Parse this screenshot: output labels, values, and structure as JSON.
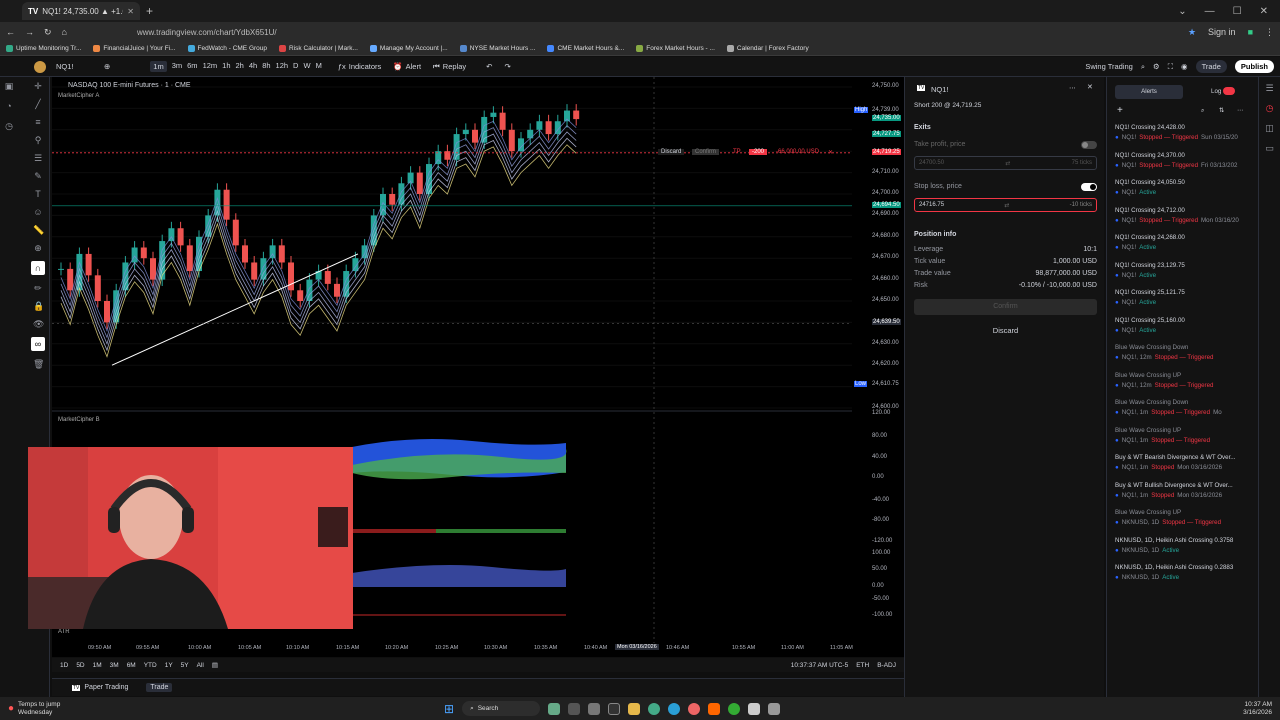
{
  "browser": {
    "tab_title": "NQ1! 24,735.00 ▲ +1.64% Swi",
    "url": "www.tradingview.com/chart/YdbX651U/",
    "sign_in": "Sign in",
    "bookmarks": [
      "Uptime Monitoring Tr...",
      "FinancialJuice | Your Fi...",
      "FedWatch - CME Group",
      "Risk Calculator | Mark...",
      "Manage My Account |...",
      "NYSE Market Hours ...",
      "CME Market Hours &...",
      "Forex Market Hours - ...",
      "Calendar | Forex Factory"
    ]
  },
  "toolbar": {
    "symbol": "NQ1!",
    "timeframes": [
      "1m",
      "3m",
      "6m",
      "12m",
      "1h",
      "2h",
      "4h",
      "8h",
      "12h",
      "D",
      "W",
      "M"
    ],
    "selected_tf": "1m",
    "indicators": "Indicators",
    "alert": "Alert",
    "replay": "Replay",
    "layout_name": "Swing Trading",
    "trade": "Trade",
    "publish": "Publish"
  },
  "chart": {
    "title": "NASDAQ 100 E-mini Futures · 1 · CME",
    "indicator_a": "MarketCipher A",
    "indicator_b": "MarketCipher B",
    "atr": "ATR",
    "high_label": "High",
    "low_label": "Low",
    "order_discard": "Discard",
    "order_confirm": "Confirm",
    "order_tp": "TP",
    "order_qty": "-200",
    "order_pnl": "-66,000.00 USD",
    "price_labels": [
      {
        "v": "24,750.00"
      },
      {
        "v": "24,739.00",
        "hl": "High"
      },
      {
        "v": "24,727.75"
      },
      {
        "v": "24,735.00"
      },
      {
        "v": "24,719.25"
      },
      {
        "v": "24,710.00"
      },
      {
        "v": "24,700.00"
      },
      {
        "v": "24,694.50"
      },
      {
        "v": "24,690.00"
      },
      {
        "v": "24,680.00"
      },
      {
        "v": "24,670.00"
      },
      {
        "v": "24,660.00"
      },
      {
        "v": "24,650.00"
      },
      {
        "v": "24,639.50"
      },
      {
        "v": "24,630.00"
      },
      {
        "v": "24,620.00"
      },
      {
        "v": "24,610.75"
      },
      {
        "v": "24,600.00"
      }
    ],
    "osc_labels": [
      "120.00",
      "80.00",
      "40.00",
      "0.00",
      "-40.00",
      "-80.00",
      "-120.00",
      "100.00",
      "50.00",
      "0.00",
      "-50.00",
      "-100.00"
    ],
    "time_labels": [
      "09:50 AM",
      "09:55 AM",
      "10:00 AM",
      "10:05 AM",
      "10:10 AM",
      "10:15 AM",
      "10:20 AM",
      "10:25 AM",
      "10:30 AM",
      "10:35 AM",
      "10:40 AM",
      "10:46 AM",
      "10:55 AM",
      "11:00 AM",
      "11:05 AM"
    ],
    "cursor_date": "Mon 03/16/2026",
    "ranges": [
      "1D",
      "5D",
      "1M",
      "3M",
      "6M",
      "YTD",
      "1Y",
      "5Y",
      "All"
    ],
    "clock": "10:37:37 AM UTC-5",
    "session": "ETH",
    "adj": "B-ADJ"
  },
  "order_panel": {
    "symbol": "NQ1!",
    "subtitle": "Short 200 @ 24,719.25",
    "exits": "Exits",
    "take_profit": "Take profit, price",
    "tp_value": "24700.50",
    "tp_ticks": "75 ticks",
    "stop_loss": "Stop loss, price",
    "sl_value": "24716.75",
    "sl_ticks": "-10 ticks",
    "position_info": "Position info",
    "rows": [
      {
        "k": "Leverage",
        "v": "10:1"
      },
      {
        "k": "Tick value",
        "v": "1,000.00 USD"
      },
      {
        "k": "Trade value",
        "v": "98,877,000.00 USD"
      },
      {
        "k": "Risk",
        "v": "-0.10% / -10,000.00 USD"
      }
    ],
    "confirm": "Confirm",
    "discard": "Discard"
  },
  "alerts": {
    "tab_alerts": "Alerts",
    "tab_log": "Log",
    "items": [
      {
        "t": "NQ1! Crossing 24,428.00",
        "s": "NQ1!",
        "st": "Stopped — Triggered",
        "d": "Sun 03/15/20"
      },
      {
        "t": "NQ1! Crossing 24,370.00",
        "s": "NQ1!",
        "st": "Stopped — Triggered",
        "d": "Fri 03/13/202"
      },
      {
        "t": "NQ1! Crossing 24,050.50",
        "s": "NQ1!",
        "ac": "Active"
      },
      {
        "t": "NQ1! Crossing 24,712.00",
        "s": "NQ1!",
        "st": "Stopped — Triggered",
        "d": "Mon 03/16/20"
      },
      {
        "t": "NQ1! Crossing 24,268.00",
        "s": "NQ1!",
        "ac": "Active"
      },
      {
        "t": "NQ1! Crossing 23,129.75",
        "s": "NQ1!",
        "ac": "Active"
      },
      {
        "t": "NQ1! Crossing 25,121.75",
        "s": "NQ1!",
        "ac": "Active"
      },
      {
        "t": "NQ1! Crossing 25,160.00",
        "s": "NQ1!",
        "ac": "Active"
      },
      {
        "t": "Blue Wave Crossing Down",
        "s": "NQ1!, 12m",
        "st": "Stopped — Triggered",
        "d": "",
        "dim": true
      },
      {
        "t": "Blue Wave Crossing UP",
        "s": "NQ1!, 12m",
        "st": "Stopped — Triggered",
        "d": "",
        "dim": true
      },
      {
        "t": "Blue Wave Crossing Down",
        "s": "NQ1!, 1m",
        "st": "Stopped — Triggered",
        "d": "Mo",
        "dim": true
      },
      {
        "t": "Blue Wave Crossing UP",
        "s": "NQ1!, 1m",
        "st": "Stopped — Triggered",
        "d": "",
        "dim": true
      },
      {
        "t": "Buy & WT Bearish Divergence & WT Over...",
        "s": "NQ1!, 1m",
        "st": "Stopped",
        "d": "Mon 03/16/2026"
      },
      {
        "t": "Buy & WT Bullish Divergence & WT Over...",
        "s": "NQ1!, 1m",
        "st": "Stopped",
        "d": "Mon 03/16/2026"
      },
      {
        "t": "Blue Wave Crossing UP",
        "s": "NKNUSD, 1D",
        "st": "Stopped — Triggered",
        "d": "",
        "dim": true
      },
      {
        "t": "NKNUSD, 1D, Heikin Ashi Crossing 0.3758",
        "s": "NKNUSD, 1D",
        "ac": "Active"
      },
      {
        "t": "NKNUSD, 1D, Heikin Ashi Crossing 0.2883",
        "s": "NKNUSD, 1D",
        "ac": "Active"
      }
    ]
  },
  "bottom": {
    "paper_trading": "Paper Trading",
    "trade": "Trade"
  },
  "taskbar": {
    "weather1": "Temps to jump",
    "weather2": "Wednesday",
    "search": "Search",
    "time": "10:37 AM",
    "date": "3/16/2026"
  }
}
